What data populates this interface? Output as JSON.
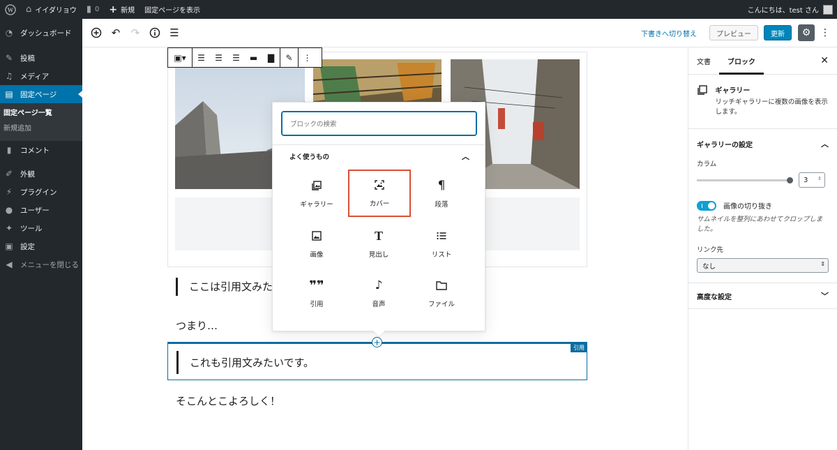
{
  "adminbar": {
    "site_name": "イイダリョウ",
    "comments_count": "0",
    "new_label": "新規",
    "view_page_label": "固定ページを表示",
    "greeting": "こんにちは、test さん"
  },
  "adminmenu": {
    "dashboard": "ダッシュボード",
    "posts": "投稿",
    "media": "メディア",
    "pages": "固定ページ",
    "pages_list": "固定ページ一覧",
    "add_new": "新規追加",
    "comments": "コメント",
    "appearance": "外観",
    "plugins": "プラグイン",
    "users": "ユーザー",
    "tools": "ツール",
    "settings": "設定",
    "collapse": "メニューを閉じる"
  },
  "header": {
    "switch_draft": "下書きへ切り替え",
    "preview": "プレビュー",
    "update": "更新"
  },
  "sidebar": {
    "tab_document": "文書",
    "tab_block": "ブロック",
    "block_title": "ギャラリー",
    "block_desc": "リッチギャラリーに複数の画像を表示します。",
    "gallery_settings": "ギャラリーの設定",
    "columns_label": "カラム",
    "columns_value": "3",
    "columns_fraction": 1.0,
    "crop_label": "画像の切り抜き",
    "crop_enabled": true,
    "crop_help": "サムネイルを整列にあわせてクロップしました。",
    "link_label": "リンク先",
    "link_value": "なし",
    "advanced": "高度な設定"
  },
  "content": {
    "quote1": "ここは引用文みた",
    "paragraph1": "つまり…",
    "quote2": "これも引用文みたいです。",
    "quote_badge": "引用",
    "paragraph2": "そこんとこよろしく！"
  },
  "inserter": {
    "search_placeholder": "ブロックの検索",
    "section_title": "よく使うもの",
    "blocks": [
      {
        "label": "ギャラリー",
        "icon": "gallery-icon"
      },
      {
        "label": "カバー",
        "icon": "cover-icon",
        "highlighted": true
      },
      {
        "label": "段落",
        "icon": "paragraph-icon"
      },
      {
        "label": "画像",
        "icon": "image-icon"
      },
      {
        "label": "見出し",
        "icon": "heading-icon"
      },
      {
        "label": "リスト",
        "icon": "list-icon"
      },
      {
        "label": "引用",
        "icon": "quote-icon"
      },
      {
        "label": "音声",
        "icon": "audio-icon"
      },
      {
        "label": "ファイル",
        "icon": "file-icon"
      }
    ]
  },
  "colors": {
    "admin_dark": "#23282d",
    "accent": "#0073aa",
    "update_button": "#0085ba",
    "highlight_border": "#d94f34",
    "toggle_on": "#11a0d2"
  }
}
